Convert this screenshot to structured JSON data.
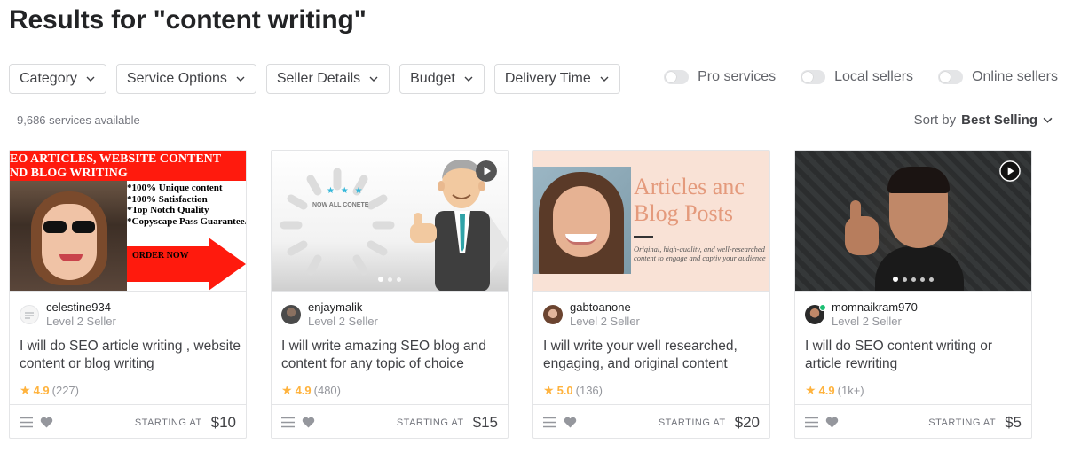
{
  "page": {
    "title": "Results for \"content writing\"",
    "services_count": "9,686 services available",
    "sort_label": "Sort by",
    "sort_value": "Best Selling"
  },
  "filters": [
    "Category",
    "Service Options",
    "Seller Details",
    "Budget",
    "Delivery Time"
  ],
  "toggles": [
    "Pro services",
    "Local sellers",
    "Online sellers"
  ],
  "colors": {
    "star": "#ffb33e",
    "online": "#1dbf73",
    "border": "#dadbdd"
  },
  "cards": [
    {
      "seller": "celestine934",
      "level": "Level 2 Seller",
      "title": "I will do SEO article writing , website content or blog writing",
      "score": "4.9",
      "reviews": "(227)",
      "price_label": "STARTING AT",
      "price": "$10",
      "thumb": {
        "line1": "EO ARTICLES, WEBSITE CONTENT",
        "line2": "ND BLOG WRITING",
        "bullets": [
          "*100% Unique content",
          "*100% Satisfaction",
          "*Top Notch Quality",
          "*Copyscape Pass Guarantee."
        ],
        "cta": "ORDER NOW"
      }
    },
    {
      "seller": "enjaymalik",
      "level": "Level 2 Seller",
      "title": "I will write amazing SEO blog and content for any topic of choice",
      "score": "4.9",
      "reviews": "(480)",
      "price_label": "STARTING AT",
      "price": "$15",
      "thumb": {
        "caption": "NOW ALL CONETE"
      }
    },
    {
      "seller": "gabtoanone",
      "level": "Level 2 Seller",
      "title": "I will write your well researched, engaging, and original content",
      "score": "5.0",
      "reviews": "(136)",
      "price_label": "STARTING AT",
      "price": "$20",
      "thumb": {
        "heading1": "Articles anc",
        "heading2": "Blog Posts",
        "tagline": "Original, high-quality, and well-researched content to engage and captiv your audience"
      }
    },
    {
      "seller": "momnaikram970",
      "level": "Level 2 Seller",
      "title": "I will do SEO content writing or article rewriting",
      "score": "4.9",
      "reviews": "(1k+)",
      "price_label": "STARTING AT",
      "price": "$5",
      "thumb": {}
    }
  ],
  "icons": [
    "chevron-down-icon",
    "star-icon",
    "menu-icon",
    "heart-icon",
    "play-icon"
  ]
}
